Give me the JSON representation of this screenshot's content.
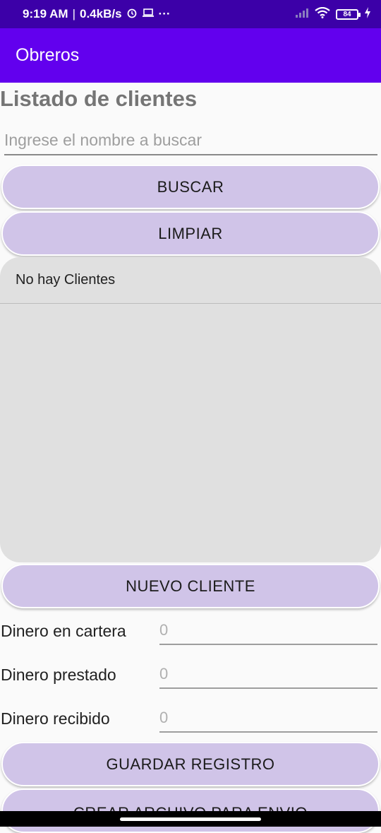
{
  "status_bar": {
    "time": "9:19 AM",
    "speed": "0.4kB/s",
    "battery": "84"
  },
  "app_bar": {
    "title": "Obreros"
  },
  "page_title": "Listado de clientes",
  "search": {
    "placeholder": "Ingrese el nombre a buscar",
    "value": ""
  },
  "buttons": {
    "search": "BUSCAR",
    "clear": "LIMPIAR",
    "new_client": "NUEVO CLIENTE",
    "save": "GUARDAR REGISTRO",
    "create_file": "CREAR ARCHIVO PARA ENVIO"
  },
  "client_list": {
    "items": [
      "No hay Clientes"
    ]
  },
  "fields": {
    "wallet": {
      "label": "Dinero en cartera",
      "placeholder": "0"
    },
    "lent": {
      "label": "Dinero prestado",
      "placeholder": "0"
    },
    "received": {
      "label": "Dinero recibido",
      "placeholder": "0"
    }
  },
  "colors": {
    "status_bar": "#3c00a8",
    "app_bar": "#6200ee",
    "button_bg": "#d0c4e8",
    "list_bg": "#e0e0e0"
  }
}
